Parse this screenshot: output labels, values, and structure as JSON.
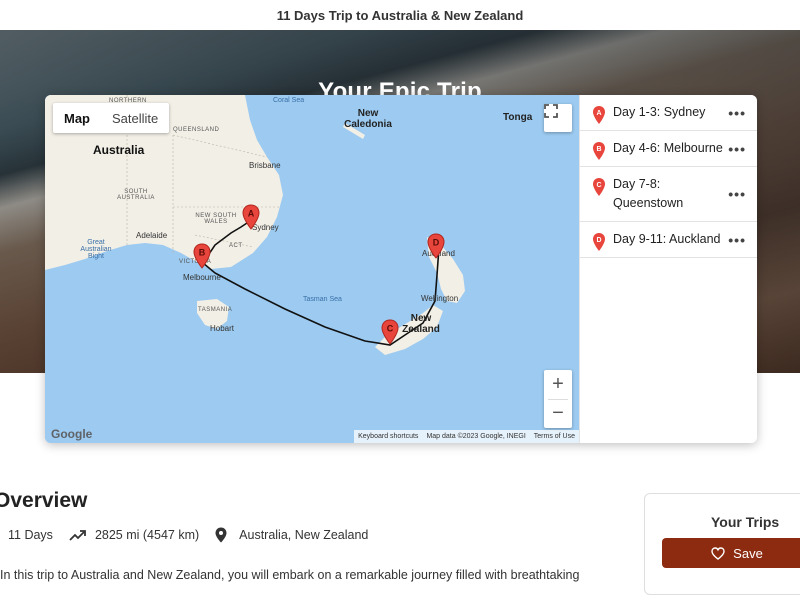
{
  "page": {
    "header_title": "11 Days Trip to Australia & New Zealand"
  },
  "hero": {
    "title": "Your Epic Trip"
  },
  "map": {
    "type_options": [
      "Map",
      "Satellite"
    ],
    "active_type": "Map",
    "zoom_in": "+",
    "zoom_out": "−",
    "logo": "Google",
    "attribution": [
      "Keyboard shortcuts",
      "Map data ©2023 Google, INEGI",
      "Terms of Use"
    ],
    "labels": {
      "australia": "Australia",
      "northern": "NORTHERN",
      "queensland": "QUEENSLAND",
      "south_australia": "SOUTH AUSTRALIA",
      "nsw": "NEW SOUTH WALES",
      "act": "ACT",
      "victoria": "VICTORIA",
      "tasmania": "TASMANIA",
      "coral_sea": "Coral Sea",
      "tasman_sea": "Tasman Sea",
      "great_bight": "Great Australian Bight",
      "new_caledonia": "New Caledonia",
      "tonga": "Tonga",
      "new_zealand": "New Zealand",
      "brisbane": "Brisbane",
      "sydney": "Sydney",
      "adelaide": "Adelaide",
      "melbourne": "Melbourne",
      "hobart": "Hobart",
      "auckland": "Auckland",
      "wellington": "Wellington"
    },
    "markers": [
      "A",
      "B",
      "C",
      "D"
    ],
    "marker_color": "#e8453c",
    "route_color": "#111111"
  },
  "stops": [
    {
      "letter": "A",
      "label": "Day 1-3: Sydney"
    },
    {
      "letter": "B",
      "label": "Day 4-6: Melbourne"
    },
    {
      "letter": "C",
      "label": "Day 7-8: Queenstown"
    },
    {
      "letter": "D",
      "label": "Day 9-11: Auckland"
    }
  ],
  "overview": {
    "title": "Overview",
    "duration": "11 Days",
    "distance": "2825 mi (4547 km)",
    "location": "Australia, New Zealand",
    "description": "In this trip to Australia and New Zealand, you will embark on a remarkable journey filled with breathtaking"
  },
  "sidebar": {
    "title": "Your Trips",
    "save_label": "Save"
  },
  "colors": {
    "accent": "#8c2b0f",
    "ocean": "#9ccaf0",
    "land": "#f2efe6"
  }
}
